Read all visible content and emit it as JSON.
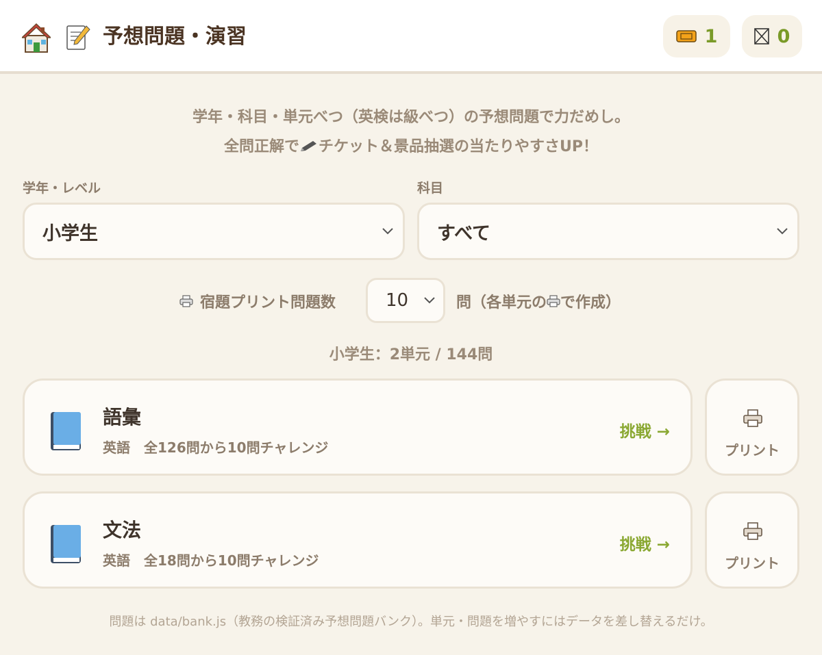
{
  "header": {
    "title": "予想問題・演習",
    "home_icon": "house-icon",
    "title_icon": "memo-icon",
    "ticket_count": "1",
    "miss_count": "0",
    "accent_color": "#7a9a28"
  },
  "intro": {
    "line1": "学年・科目・単元べつ（英検は級べつ）の予想問題で力だめし。",
    "line2_before": "全問正解で",
    "line2_after": "チケット＆景品抽選の当たりやすさUP！"
  },
  "filters": {
    "grade_label": "学年・レベル",
    "grade_value": "小学生",
    "subject_label": "科目",
    "subject_value": "すべて"
  },
  "print_settings": {
    "label": "宿題プリント問題数",
    "count": "10",
    "suffix_before": "問（各単元の",
    "suffix_after": "で作成）"
  },
  "summary": "小学生：2単元 / 144問",
  "units": [
    {
      "title": "語彙",
      "subtitle": "英語　全126問から10問チャレンジ",
      "action": "挑戦 →",
      "print_label": "プリント"
    },
    {
      "title": "文法",
      "subtitle": "英語　全18問から10問チャレンジ",
      "action": "挑戦 →",
      "print_label": "プリント"
    }
  ],
  "footer": "問題は data/bank.js（教務の検証済み予想問題バンク）。単元・問題を増やすにはデータを差し替えるだけ。"
}
